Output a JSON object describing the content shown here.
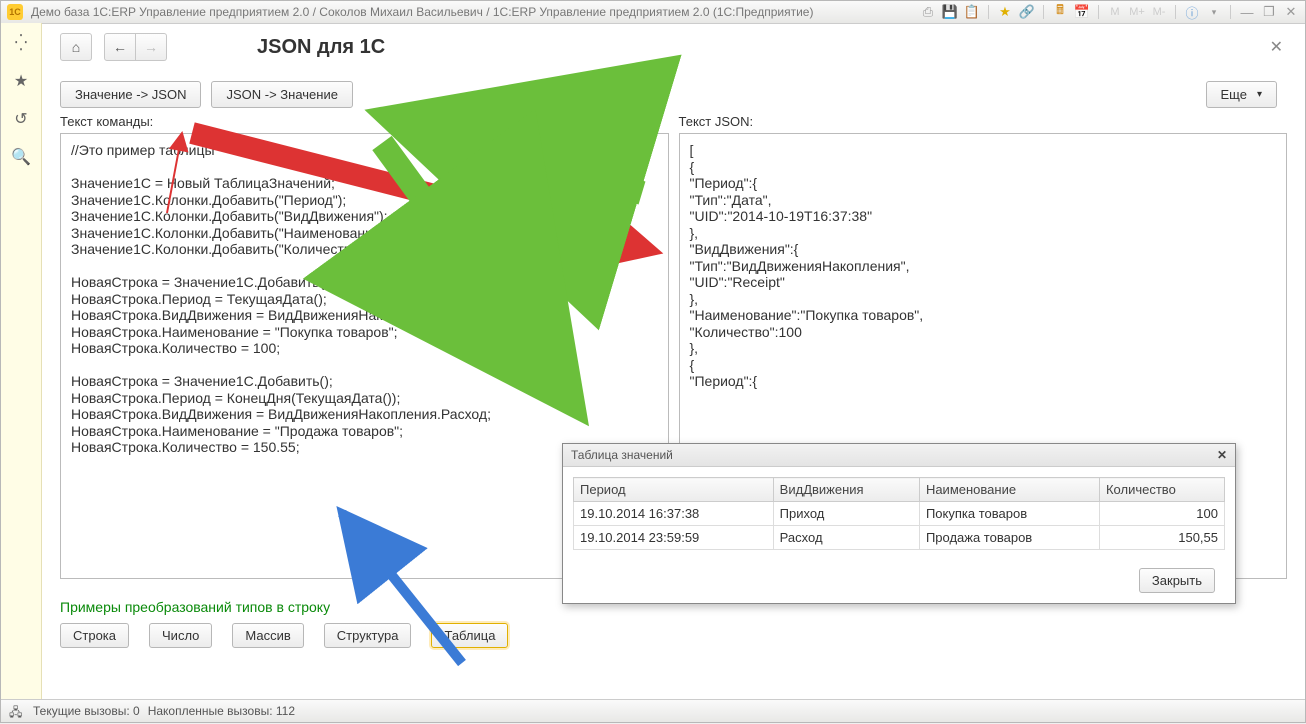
{
  "titlebar": {
    "logo": "1C",
    "text": "Демо база 1C:ERP Управление предприятием 2.0 / Соколов Михаил Васильевич / 1C:ERP Управление предприятием 2.0  (1С:Предприятие)"
  },
  "page": {
    "title": "JSON для 1С",
    "btn_value_to_json": "Значение -> JSON",
    "btn_json_to_value": "JSON -> Значение",
    "more": "Еще",
    "label_command": "Текст команды:",
    "label_json": "Текст JSON:",
    "command_text": "//Это пример таблицы\n\nЗначение1С = Новый ТаблицаЗначений;\nЗначение1С.Колонки.Добавить(\"Период\");\nЗначение1С.Колонки.Добавить(\"ВидДвижения\");\nЗначение1С.Колонки.Добавить(\"Наименование\");\nЗначение1С.Колонки.Добавить(\"Количество\");\n\nНоваяСтрока = Значение1С.Добавить();\nНоваяСтрока.Период = ТекущаяДата();\nНоваяСтрока.ВидДвижения = ВидДвиженияНакопления.Приход;\nНоваяСтрока.Наименование = \"Покупка товаров\";\nНоваяСтрока.Количество = 100;\n\nНоваяСтрока = Значение1С.Добавить();\nНоваяСтрока.Период = КонецДня(ТекущаяДата());\nНоваяСтрока.ВидДвижения = ВидДвиженияНакопления.Расход;\nНоваяСтрока.Наименование = \"Продажа товаров\";\nНоваяСтрока.Количество = 150.55;",
    "json_text": "[\n{\n\"Период\":{\n\"Тип\":\"Дата\",\n\"UID\":\"2014-10-19T16:37:38\"\n},\n\"ВидДвижения\":{\n\"Тип\":\"ВидДвиженияНакопления\",\n\"UID\":\"Receipt\"\n},\n\"Наименование\":\"Покупка товаров\",\n\"Количество\":100\n},\n{\n\"Период\":{\n\n\n\n\n\n\n\n\n\n}\n]"
  },
  "examples": {
    "title": "Примеры преобразований типов в строку",
    "buttons": [
      "Строка",
      "Число",
      "Массив",
      "Структура",
      "Таблица"
    ]
  },
  "popup": {
    "title": "Таблица значений",
    "headers": [
      "Период",
      "ВидДвижения",
      "Наименование",
      "Количество"
    ],
    "rows": [
      [
        "19.10.2014 16:37:38",
        "Приход",
        "Покупка товаров",
        "100"
      ],
      [
        "19.10.2014 23:59:59",
        "Расход",
        "Продажа товаров",
        "150,55"
      ]
    ],
    "close": "Закрыть"
  },
  "status": {
    "current": "Текущие вызовы: 0",
    "accumulated": "Накопленные вызовы: 112"
  }
}
